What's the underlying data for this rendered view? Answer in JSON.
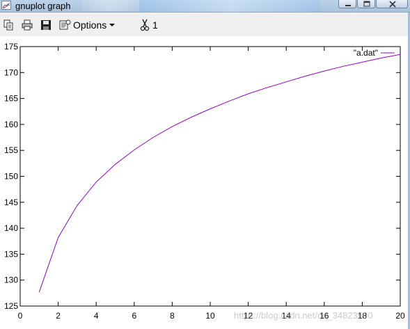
{
  "window": {
    "title": "gnuplot graph",
    "accent": "#a9c2dc"
  },
  "toolbar": {
    "copy_icon": "copy-icon",
    "print_icon": "print-icon",
    "save_icon": "save-icon",
    "options_icon": "options-icon",
    "options_label": "Options",
    "scissors_icon": "scissors-icon",
    "counter": "1"
  },
  "watermark": "https://blog.csdn.net/qq_34823990",
  "chart_data": {
    "type": "line",
    "title": "",
    "xlabel": "",
    "ylabel": "",
    "xlim": [
      0,
      20
    ],
    "ylim": [
      125,
      175
    ],
    "xticks": [
      "0",
      "2",
      "4",
      "6",
      "8",
      "10",
      "12",
      "14",
      "16",
      "18",
      "20"
    ],
    "yticks": [
      "125",
      "130",
      "135",
      "140",
      "145",
      "150",
      "155",
      "160",
      "165",
      "170",
      "175"
    ],
    "grid": false,
    "legend": "top-right",
    "series": [
      {
        "name": "\"a.dat\"",
        "color": "#9400d3",
        "x": [
          1,
          2,
          3,
          4,
          5,
          6,
          7,
          8,
          9,
          10,
          11,
          12,
          13,
          14,
          15,
          16,
          17,
          18,
          19,
          20
        ],
        "y": [
          127.7,
          138.2,
          144.4,
          148.9,
          152.3,
          155.1,
          157.5,
          159.6,
          161.4,
          163.0,
          164.5,
          165.9,
          167.1,
          168.2,
          169.3,
          170.3,
          171.2,
          172.0,
          172.8,
          173.5
        ]
      }
    ]
  }
}
